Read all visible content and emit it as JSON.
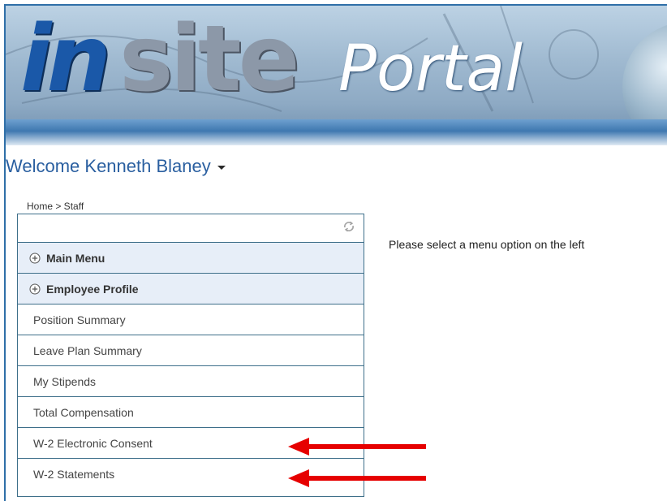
{
  "banner": {
    "logo_in": "in",
    "logo_site": "site",
    "logo_portal": "Portal"
  },
  "welcome": {
    "text": "Welcome Kenneth Blaney"
  },
  "breadcrumb": "Home > Staff",
  "menu": {
    "sections": [
      {
        "label": "Main Menu",
        "icon": "plus-circle-icon"
      },
      {
        "label": "Employee Profile",
        "icon": "plus-circle-icon"
      }
    ],
    "items": [
      {
        "label": "Position Summary"
      },
      {
        "label": "Leave Plan Summary"
      },
      {
        "label": "My Stipends"
      },
      {
        "label": "Total Compensation"
      },
      {
        "label": "W-2 Electronic Consent"
      },
      {
        "label": "W-2 Statements"
      }
    ],
    "refresh_icon": "refresh-icon"
  },
  "content": {
    "message": "Please select a menu option on the left"
  },
  "annotations": {
    "arrow_color": "#e60000"
  },
  "colors": {
    "header_text": "#2a5fa0",
    "panel_border": "#3e6f8a",
    "section_bg": "#e7eef8"
  }
}
